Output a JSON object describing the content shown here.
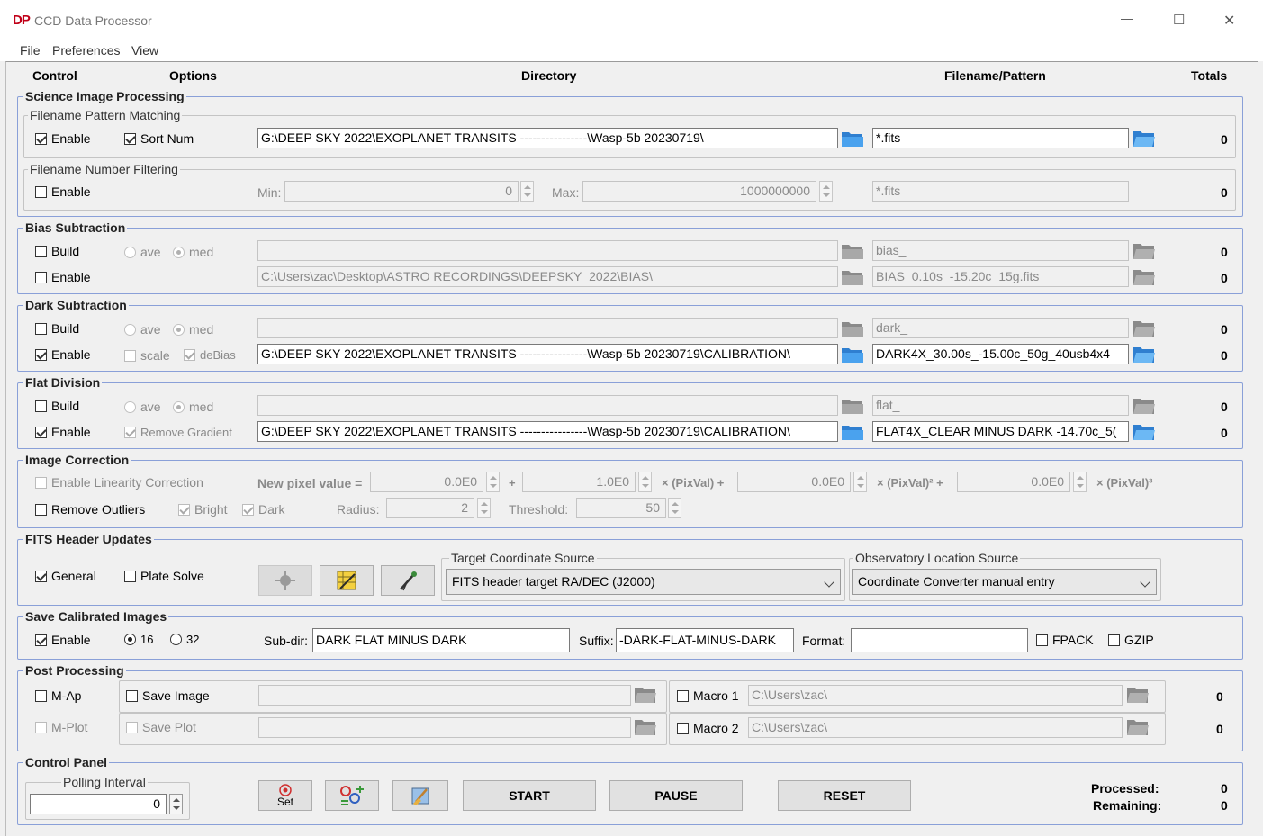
{
  "window": {
    "app_icon": "DP",
    "title": "CCD Data Processor",
    "minimize": "—",
    "maximize": "☐",
    "close": "✕"
  },
  "menu": {
    "file": "File",
    "preferences": "Preferences",
    "view": "View"
  },
  "columns": {
    "control": "Control",
    "options": "Options",
    "directory": "Directory",
    "filename": "Filename/Pattern",
    "totals": "Totals"
  },
  "science": {
    "title": "Science Image Processing",
    "pattern_title": "Filename Pattern Matching",
    "enable": "Enable",
    "sort_num": "Sort Num",
    "dir": "G:\\DEEP SKY 2022\\EXOPLANET TRANSITS ----------------\\Wasp-5b  20230719\\",
    "pattern": "*.fits",
    "total": "0",
    "number_title": "Filename Number Filtering",
    "num_enable": "Enable",
    "min_label": "Min:",
    "min": "0",
    "max_label": "Max:",
    "max": "1000000000",
    "num_pattern": "*.fits",
    "num_total": "0"
  },
  "bias": {
    "title": "Bias Subtraction",
    "build": "Build",
    "ave": "ave",
    "med": "med",
    "build_dir": "",
    "build_pattern": "bias_",
    "build_total": "0",
    "enable": "Enable",
    "dir": "C:\\Users\\zac\\Desktop\\ASTRO  RECORDINGS\\DEEPSKY_2022\\BIAS\\",
    "file": "BIAS_0.10s_-15.20c_15g.fits",
    "total": "0"
  },
  "dark": {
    "title": "Dark Subtraction",
    "build": "Build",
    "ave": "ave",
    "med": "med",
    "build_dir": "",
    "build_pattern": "dark_",
    "build_total": "0",
    "enable": "Enable",
    "scale": "scale",
    "debias": "deBias",
    "dir": "G:\\DEEP SKY 2022\\EXOPLANET TRANSITS ----------------\\Wasp-5b  20230719\\CALIBRATION\\",
    "file": "DARK4X_30.00s_-15.00c_50g_40usb4x4",
    "total": "0"
  },
  "flat": {
    "title": "Flat Division",
    "build": "Build",
    "ave": "ave",
    "med": "med",
    "build_dir": "",
    "build_pattern": "flat_",
    "build_total": "0",
    "enable": "Enable",
    "remove_gradient": "Remove Gradient",
    "dir": "G:\\DEEP SKY 2022\\EXOPLANET TRANSITS ----------------\\Wasp-5b  20230719\\CALIBRATION\\",
    "file": "FLAT4X_CLEAR MINUS DARK -14.70c_5(",
    "total": "0"
  },
  "correction": {
    "title": "Image Correction",
    "linearity": "Enable Linearity Correction",
    "new_pixel": "New pixel value =",
    "c0": "0.0E0",
    "plus": "+",
    "c1": "1.0E0",
    "t1": "× (PixVal) +",
    "c2": "0.0E0",
    "t2": "× (PixVal)² +",
    "c3": "0.0E0",
    "t3": "× (PixVal)³",
    "outliers": "Remove Outliers",
    "bright": "Bright",
    "dark": "Dark",
    "radius_label": "Radius:",
    "radius": "2",
    "threshold_label": "Threshold:",
    "threshold": "50"
  },
  "fits": {
    "title": "FITS Header Updates",
    "general": "General",
    "plate_solve": "Plate Solve",
    "target_title": "Target Coordinate Source",
    "target_value": "FITS header target RA/DEC (J2000)",
    "obs_title": "Observatory Location Source",
    "obs_value": "Coordinate Converter manual entry"
  },
  "save": {
    "title": "Save Calibrated Images",
    "enable": "Enable",
    "b16": "16",
    "b32": "32",
    "subdir_label": "Sub-dir:",
    "subdir": "DARK FLAT MINUS DARK",
    "suffix_label": "Suffix:",
    "suffix": "-DARK-FLAT-MINUS-DARK",
    "format_label": "Format:",
    "format": "",
    "fpack": "FPACK",
    "gzip": "GZIP"
  },
  "post": {
    "title": "Post Processing",
    "map": "M-Ap",
    "save_image": "Save Image",
    "image_dir": "",
    "macro1": "Macro 1",
    "macro1_dir": "C:\\Users\\zac\\",
    "macro1_total": "0",
    "mplot": "M-Plot",
    "save_plot": "Save Plot",
    "plot_dir": "",
    "macro2": "Macro 2",
    "macro2_dir": "C:\\Users\\zac\\",
    "macro2_total": "0"
  },
  "control": {
    "title": "Control Panel",
    "polling_title": "Polling Interval",
    "polling": "0",
    "set_label": "Set",
    "start": "START",
    "pause": "PAUSE",
    "reset": "RESET",
    "processed_label": "Processed:",
    "processed": "0",
    "remaining_label": "Remaining:",
    "remaining": "0"
  }
}
